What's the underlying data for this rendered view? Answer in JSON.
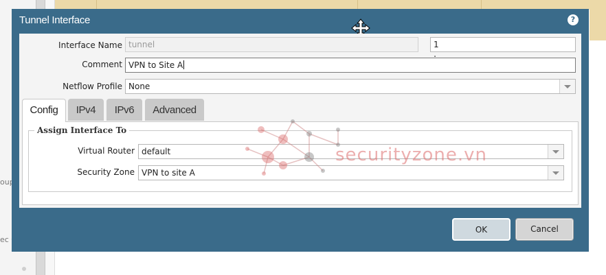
{
  "background": {
    "left_labels": [
      "oup",
      "ec C"
    ]
  },
  "dialog": {
    "title": "Tunnel Interface",
    "help_icon": "help-circle-icon",
    "move_icon": "move-cursor-icon"
  },
  "form": {
    "interface_name_label": "Interface Name",
    "interface_name_value": "tunnel",
    "interface_suffix_sep": ".",
    "interface_suffix_value": "1",
    "comment_label": "Comment",
    "comment_value": "VPN to Site A",
    "netflow_label": "Netflow Profile",
    "netflow_value": "None"
  },
  "tabs": [
    {
      "label": "Config",
      "active": true
    },
    {
      "label": "IPv4",
      "active": false
    },
    {
      "label": "IPv6",
      "active": false
    },
    {
      "label": "Advanced",
      "active": false
    }
  ],
  "config": {
    "legend": "Assign Interface To",
    "virtual_router_label": "Virtual Router",
    "virtual_router_value": "default",
    "security_zone_label": "Security Zone",
    "security_zone_value": "VPN to site A"
  },
  "watermark": {
    "text": "securityzone.vn",
    "color": "#dc6e6e"
  },
  "buttons": {
    "ok": "OK",
    "cancel": "Cancel"
  },
  "colors": {
    "dialog_header": "#3a6b8a",
    "form_bg": "#f4f4f4",
    "bg_accent": "#ecd9a8"
  }
}
